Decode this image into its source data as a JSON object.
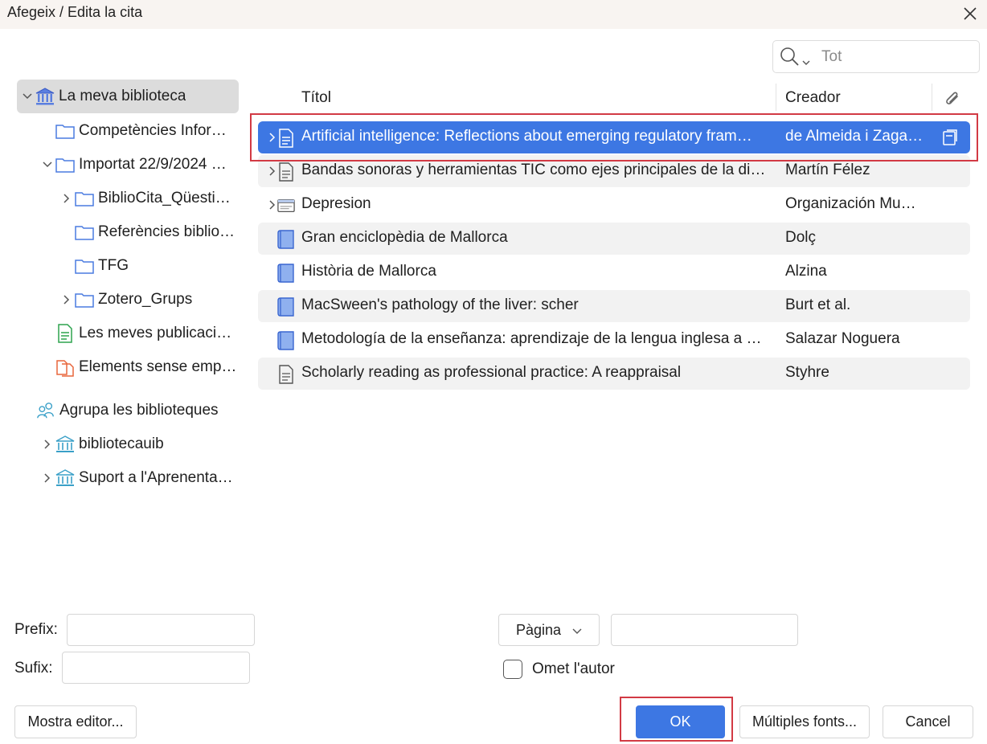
{
  "window": {
    "title": "Afegeix / Edita la cita",
    "close_icon": "close-icon"
  },
  "search": {
    "placeholder": "Tot",
    "icon": "search-icon"
  },
  "sidebar": {
    "items": [
      {
        "label": "La meva biblioteca",
        "icon": "library-icon",
        "twisty": "expanded",
        "selected": true
      },
      {
        "label": "Competències Infor…",
        "icon": "folder-icon",
        "twisty": "none"
      },
      {
        "label": "Importat 22/9/2024 …",
        "icon": "folder-icon",
        "twisty": "expanded"
      },
      {
        "label": "BiblioCita_Qüesti…",
        "icon": "folder-icon",
        "twisty": "collapsed"
      },
      {
        "label": "Referències biblio…",
        "icon": "folder-icon",
        "twisty": "none"
      },
      {
        "label": "TFG",
        "icon": "folder-icon",
        "twisty": "none"
      },
      {
        "label": "Zotero_Grups",
        "icon": "folder-icon",
        "twisty": "collapsed"
      },
      {
        "label": "Les meves publicaci…",
        "icon": "publications-icon",
        "twisty": "none"
      },
      {
        "label": "Elements sense emp…",
        "icon": "unfiled-items-icon",
        "twisty": "none"
      },
      {
        "label": "Agrupa les biblioteques",
        "icon": "group-icon",
        "twisty": "none"
      },
      {
        "label": "bibliotecauib",
        "icon": "group-library-icon",
        "twisty": "collapsed"
      },
      {
        "label": "Suport a l'Aprenenta…",
        "icon": "group-library-icon",
        "twisty": "collapsed"
      }
    ]
  },
  "table": {
    "columns": {
      "title": "Títol",
      "creator": "Creador",
      "attachment_icon": "paperclip-icon"
    },
    "rows": [
      {
        "title": "Artificial intelligence: Reflections about emerging regulatory fram…",
        "creator": "de Almeida i Zaga…",
        "type": "document-icon",
        "twisty": true,
        "attachment": true,
        "selected": true
      },
      {
        "title": "Bandas sonoras y herramientas TIC como ejes principales de la di…",
        "creator": "Martín Félez",
        "type": "document-icon",
        "twisty": true
      },
      {
        "title": "Depresion",
        "creator": "Organización Mu…",
        "type": "webpage-icon",
        "twisty": true
      },
      {
        "title": "Gran enciclopèdia de Mallorca",
        "creator": "Dolç",
        "type": "book-icon",
        "twisty": false
      },
      {
        "title": "Història de Mallorca",
        "creator": "Alzina",
        "type": "book-icon",
        "twisty": false
      },
      {
        "title": "MacSween's pathology of the liver: scher",
        "creator": "Burt et al.",
        "type": "book-icon",
        "twisty": false
      },
      {
        "title": "Metodología de la enseñanza: aprendizaje de la lengua inglesa a …",
        "creator": "Salazar Noguera",
        "type": "book-icon",
        "twisty": false
      },
      {
        "title": "Scholarly reading as professional practice: A reappraisal",
        "creator": "Styhre",
        "type": "document-icon",
        "twisty": false
      }
    ]
  },
  "form": {
    "prefix_label": "Prefix:",
    "prefix_value": "",
    "suffix_label": "Sufix:",
    "suffix_value": "",
    "locator_select": "Pàgina",
    "locator_value": "",
    "omit_author_label": "Omet l'autor",
    "omit_author_checked": false
  },
  "buttons": {
    "show_editor": "Mostra editor...",
    "ok": "OK",
    "multiple_sources": "Múltiples fonts...",
    "cancel": "Cancel"
  },
  "colors": {
    "accent": "#3d77e3",
    "highlight_border": "#d23a44",
    "selected_tree": "#dcdcdc"
  }
}
